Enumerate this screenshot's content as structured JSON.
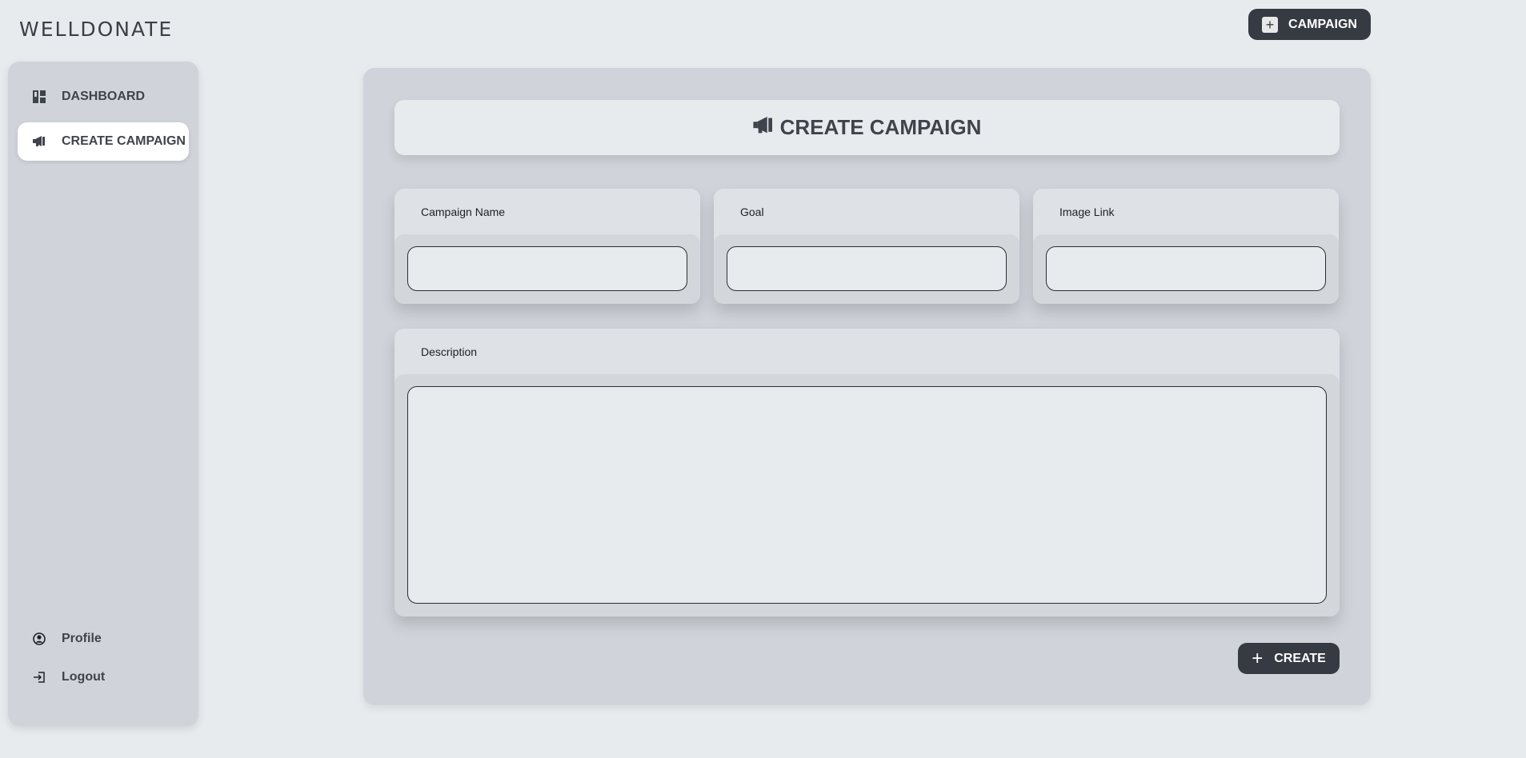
{
  "app": {
    "logo": "WELLDONATE"
  },
  "header": {
    "campaign_button_label": "CAMPAIGN"
  },
  "sidebar": {
    "items": [
      {
        "label": "DASHBOARD",
        "icon": "dashboard-icon"
      },
      {
        "label": "CREATE CAMPAIGN",
        "icon": "megaphone-icon",
        "active": true
      }
    ],
    "bottom_items": [
      {
        "label": "Profile",
        "icon": "user-circle-icon"
      },
      {
        "label": "Logout",
        "icon": "logout-icon"
      }
    ]
  },
  "main": {
    "title": "CREATE CAMPAIGN",
    "fields": [
      {
        "label": "Campaign Name",
        "value": ""
      },
      {
        "label": "Goal",
        "value": ""
      },
      {
        "label": "Image Link",
        "value": ""
      }
    ],
    "description": {
      "label": "Description",
      "value": ""
    },
    "create_button_label": "CREATE"
  },
  "colors": {
    "background": "#e8ebee",
    "panel": "#d0d4da",
    "button": "#363a42",
    "text": "#3f444c"
  }
}
